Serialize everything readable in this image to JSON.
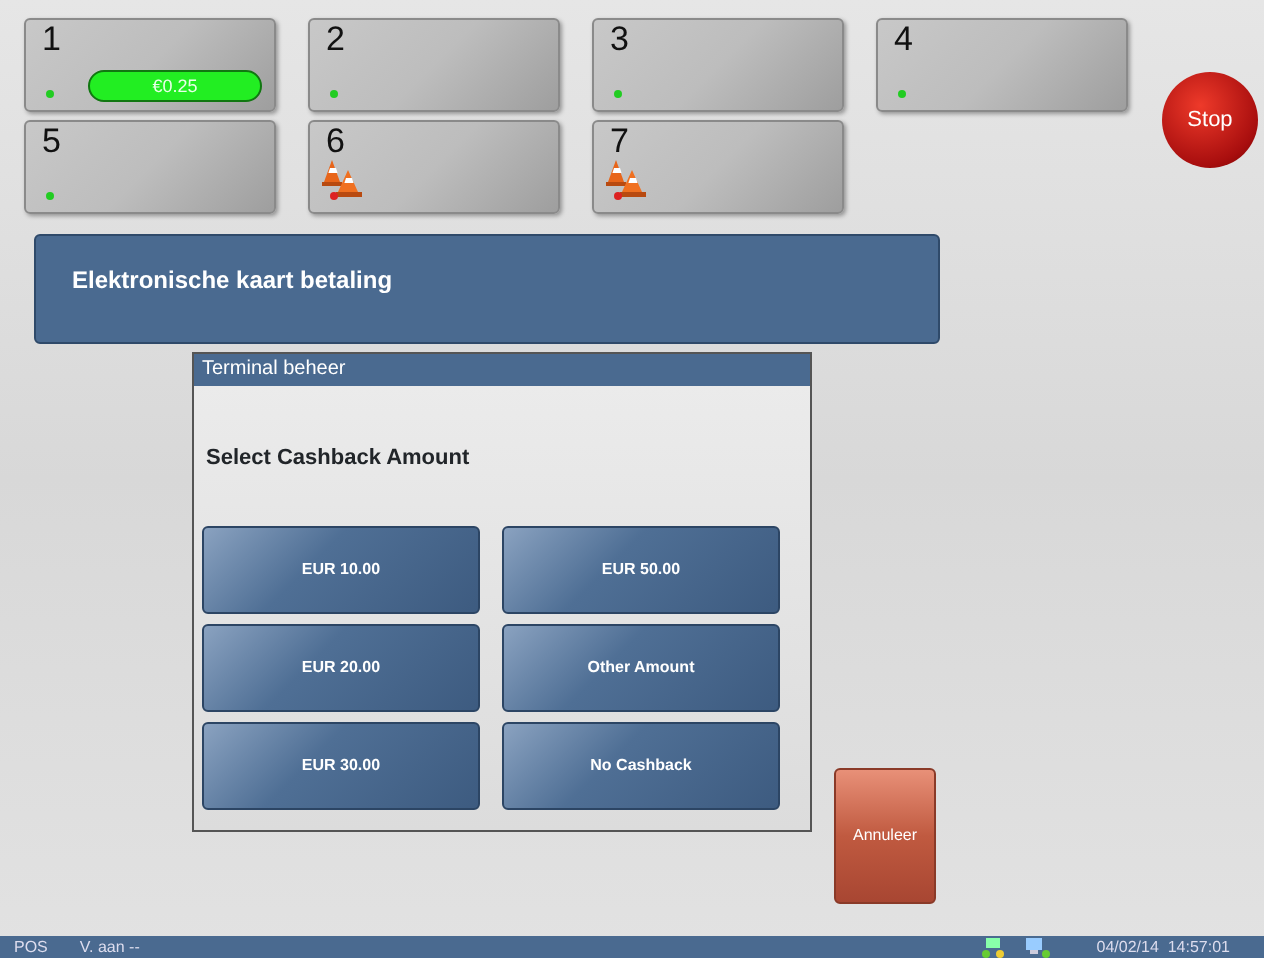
{
  "pumps": [
    {
      "number": "1",
      "color": "#22cc22",
      "amount": "€0.25",
      "alert": false
    },
    {
      "number": "2",
      "color": "#22cc22",
      "alert": false
    },
    {
      "number": "3",
      "color": "#22cc22",
      "alert": false
    },
    {
      "number": "4",
      "color": "#22cc22",
      "alert": false
    },
    {
      "number": "5",
      "color": "#22cc22",
      "alert": false
    },
    {
      "number": "6",
      "color": "#dd2222",
      "alert": true
    },
    {
      "number": "7",
      "color": "#dd2222",
      "alert": true
    }
  ],
  "stop_button": "Stop",
  "banner": "Elektronische kaart betaling",
  "dialog": {
    "title": "Terminal beheer",
    "prompt": "Select Cashback Amount",
    "options": [
      "EUR 10.00",
      "EUR 50.00",
      "EUR 20.00",
      "Other Amount",
      "EUR 30.00",
      "No Cashback"
    ]
  },
  "cancel_button": "Annuleer",
  "status_bar": {
    "mode": "POS",
    "user": "V. aan --",
    "datetime": "04/02/14  14:57:01"
  }
}
